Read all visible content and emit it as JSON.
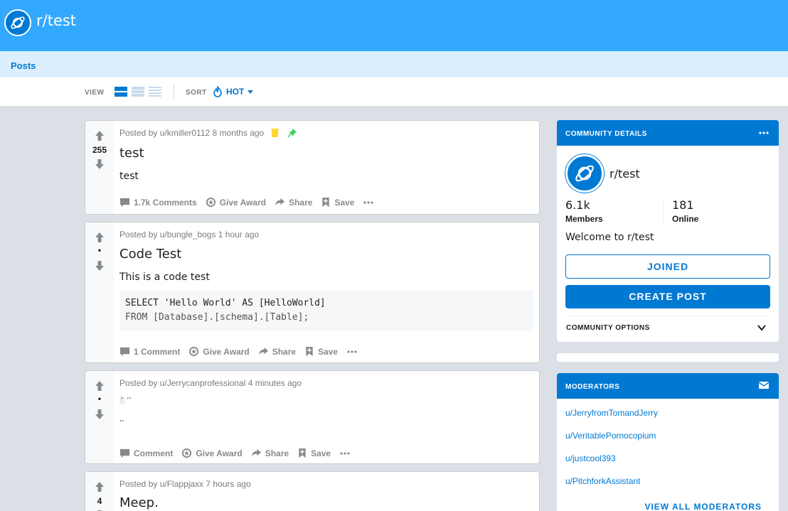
{
  "header": {
    "title": "r/test",
    "icon": "planet-icon"
  },
  "nav": {
    "posts_tab": "Posts"
  },
  "toolbar": {
    "view_label": "VIEW",
    "view_modes": [
      "card",
      "classic",
      "compact"
    ],
    "sort_label": "SORT",
    "sort_value": "HOT"
  },
  "posts": [
    {
      "votes": "255",
      "meta": "Posted by u/kmiller0112 8 months ago",
      "title": "test",
      "text": "test",
      "actions": {
        "comments": "1.7k Comments",
        "award": "Give Award",
        "share": "Share",
        "save": "Save"
      }
    },
    {
      "votes": "•",
      "meta": "Posted by u/bungle_bogs 1 hour ago",
      "title": "Code Test",
      "text": "This is a code test",
      "code": [
        "SELECT 'Hello World' AS [HelloWorld]",
        "FROM [Database].[schema].[Table];"
      ],
      "actions": {
        "comments": "1 Comment",
        "award": "Give Award",
        "share": "Share",
        "save": "Save"
      }
    },
    {
      "votes": "•",
      "meta": "Posted by u/Jerrycanprofessional 4 minutes ago",
      "line1_a": "‘",
      "line1_b": "‘’",
      "line2": "’’",
      "actions": {
        "comments": "Comment",
        "award": "Give Award",
        "share": "Share",
        "save": "Save"
      }
    },
    {
      "votes": "4",
      "meta": "Posted by u/Flappjaxx 7 hours ago",
      "title": "Meep."
    }
  ],
  "sidebar": {
    "details_heading": "COMMUNITY DETAILS",
    "community_name": "r/test",
    "members_count": "6.1k",
    "members_label": "Members",
    "online_count": "181",
    "online_label": "Online",
    "welcome": "Welcome to r/test",
    "joined_button": "JOINED",
    "create_post_button": "CREATE POST",
    "community_options": "COMMUNITY OPTIONS",
    "moderators_heading": "MODERATORS",
    "moderators": [
      "u/JerryfromTomandJerry",
      "u/VeritablePornocopium",
      "u/justcool393",
      "u/PitchforkAssistant"
    ],
    "view_all": "VIEW ALL MODERATORS"
  },
  "colors": {
    "brand_blue": "#0079d3",
    "banner": "#33a8ff",
    "posts_bar": "#dbeffe",
    "background": "#dae0e6"
  }
}
